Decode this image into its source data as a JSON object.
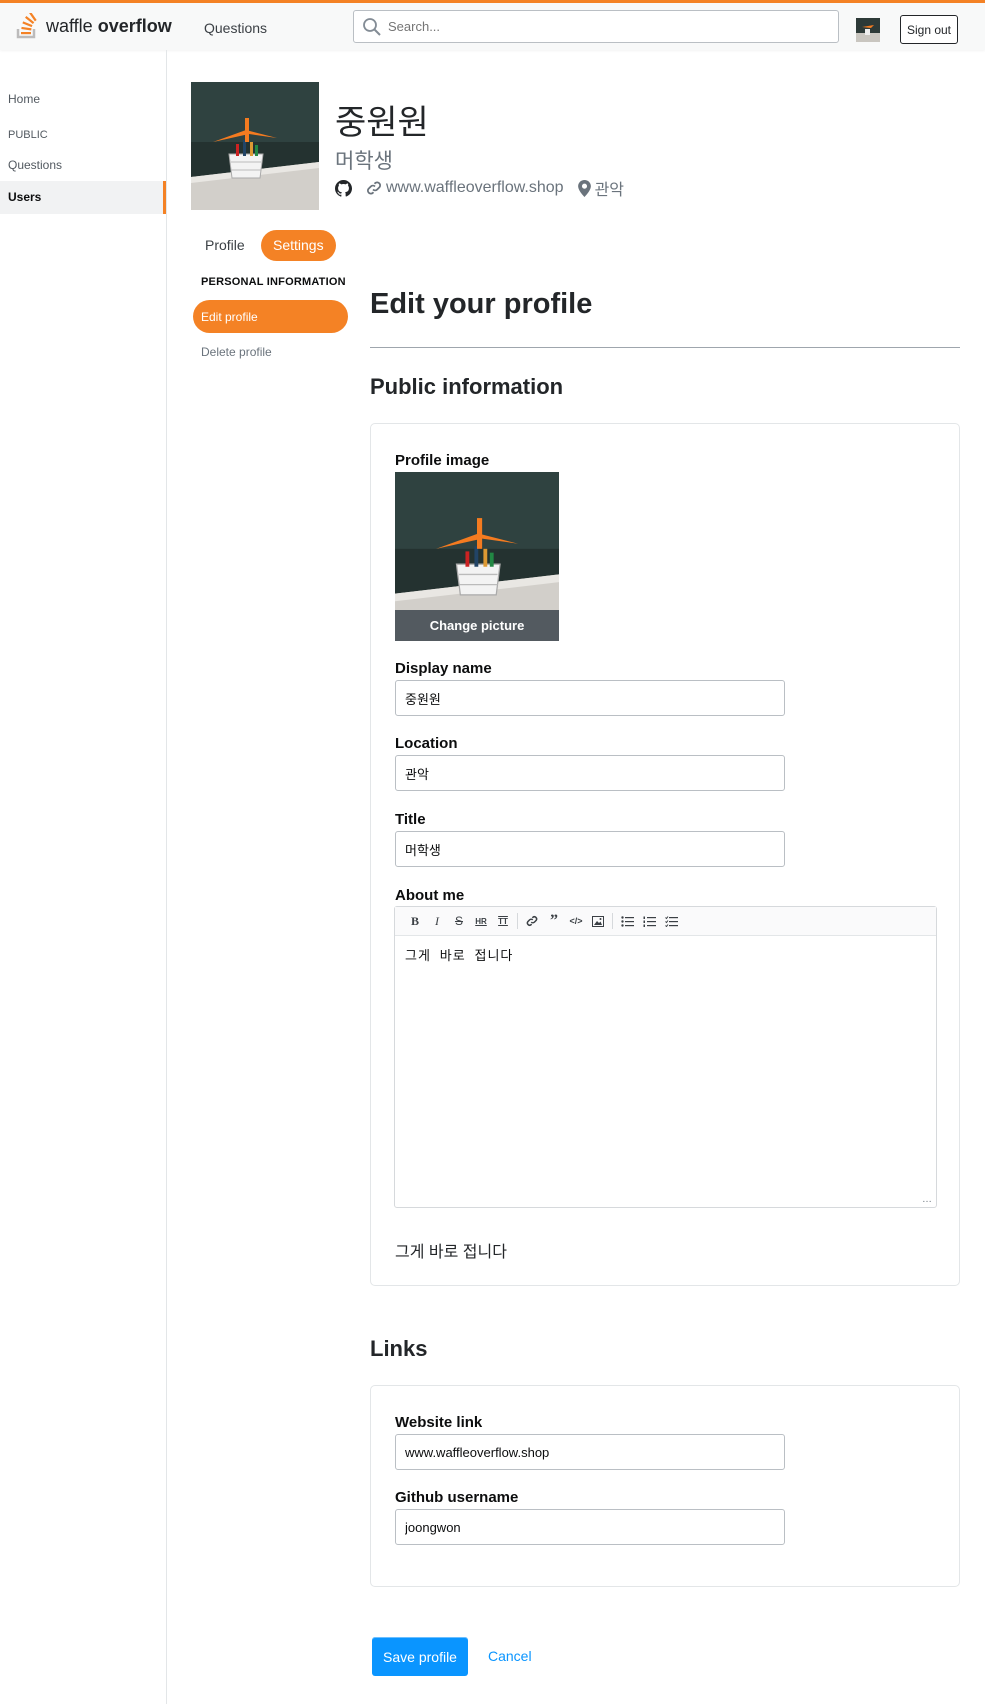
{
  "brand": {
    "name_light": "waffle",
    "name_bold": "overflow",
    "accent": "#f48225"
  },
  "topnav": {
    "questions_label": "Questions",
    "search_placeholder": "Search...",
    "signout_label": "Sign out"
  },
  "leftnav": {
    "home": "Home",
    "public": "PUBLIC",
    "questions": "Questions",
    "users": "Users"
  },
  "profile": {
    "name": "중원원",
    "title": "머학생",
    "website": "www.waffleoverflow.shop",
    "location": "관악"
  },
  "tabs": {
    "profile": "Profile",
    "settings": "Settings"
  },
  "settings_nav": {
    "heading": "PERSONAL INFORMATION",
    "edit": "Edit profile",
    "delete": "Delete profile"
  },
  "form": {
    "heading": "Edit your profile",
    "public_heading": "Public information",
    "profile_image_label": "Profile image",
    "change_picture": "Change picture",
    "display_name_label": "Display name",
    "display_name_value": "중원원",
    "location_label": "Location",
    "location_value": "관악",
    "title_label": "Title",
    "title_value": "머학생",
    "about_label": "About me",
    "about_value": "그게 바로 접니다",
    "about_preview": "그게 바로 접니다",
    "links_heading": "Links",
    "website_label": "Website link",
    "website_value": "www.waffleoverflow.shop",
    "github_label": "Github username",
    "github_value": "joongwon",
    "save_label": "Save profile",
    "cancel_label": "Cancel",
    "primary_color": "#0a95ff"
  },
  "editor_toolbar": [
    "bold-icon",
    "italic-icon",
    "strikethrough-icon",
    "hr-icon",
    "heading-icon",
    "link-icon",
    "quote-icon",
    "code-icon",
    "image-icon",
    "bullet-list-icon",
    "numbered-list-icon",
    "task-list-icon"
  ]
}
